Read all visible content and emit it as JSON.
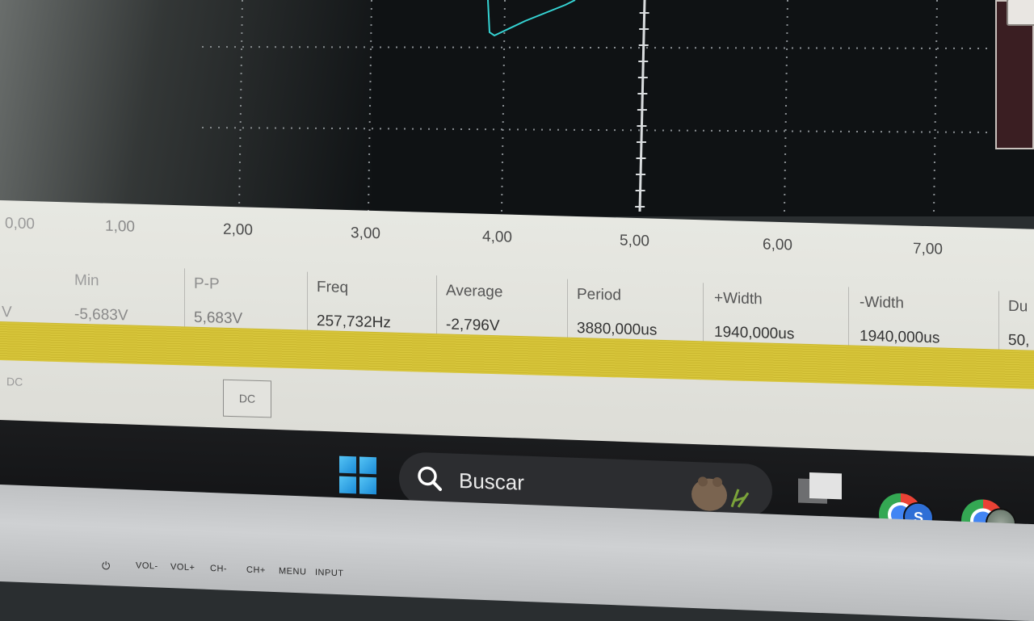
{
  "scope": {
    "trace_color": "#35d3d3",
    "grid_color": "#8a8f93"
  },
  "time_axis": {
    "ticks": [
      "0,00",
      "1,00",
      "2,00",
      "3,00",
      "4,00",
      "5,00",
      "6,00",
      "7,00"
    ]
  },
  "measurements": [
    {
      "label": "Min",
      "value": "-5,683V"
    },
    {
      "label": "P-P",
      "value": "5,683V"
    },
    {
      "label": "Freq",
      "value": "257,732Hz"
    },
    {
      "label": "Average",
      "value": "-2,796V"
    },
    {
      "label": "Period",
      "value": "3880,000us"
    },
    {
      "label": "+Width",
      "value": "1940,000us"
    },
    {
      "label": "-Width",
      "value": "1940,000us"
    },
    {
      "label": "Du",
      "value": "50,"
    }
  ],
  "partial_value_left": "V",
  "coupling": {
    "left": "DC",
    "button": "DC"
  },
  "channel_bar_color": "#d7c53a",
  "taskbar": {
    "search_placeholder": "Buscar",
    "profile_initial": "S"
  },
  "monitor_buttons": [
    "VOL-",
    "VOL+",
    "CH-",
    "CH+",
    "MENU",
    "INPUT"
  ]
}
